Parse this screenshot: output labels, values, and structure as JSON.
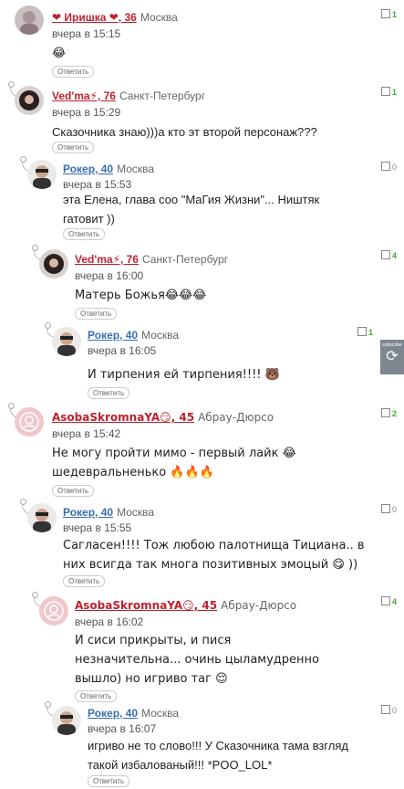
{
  "comments": [
    {
      "author": "❤ Иришка ❤, 36",
      "city": "Москва",
      "time": "вчера в 15:15",
      "text": "😂",
      "reply": "Ответить",
      "rating": "1"
    },
    {
      "author": "Ved'ma⚡, 76",
      "city": "Санкт-Петербург",
      "time": "вчера в 15:29",
      "text": "Сказочника знаю)))а кто эт второй персонаж???",
      "reply": "Ответить",
      "rating": "1"
    },
    {
      "author": "Рокер, 40",
      "city": "Москва",
      "time": "вчера в 15:53",
      "text": "эта Елена, глава соо \"МаГия Жизни\"... Ништяк гатовит ))",
      "reply": "Ответить",
      "rating": "0"
    },
    {
      "author": "Ved'ma⚡, 76",
      "city": "Санкт-Петербург",
      "time": "вчера в 16:00",
      "text": "Матерь Божья😂😂😂",
      "reply": "Ответить",
      "rating": "4"
    },
    {
      "author": "Рокер, 40",
      "city": "Москва",
      "time": "вчера в 16:05",
      "text": "И тирпения ей тирпения!!!! 🐻",
      "reply": "Ответить",
      "rating": "1"
    },
    {
      "author": "AsobaSkromnaYA😏, 45",
      "city": "Абрау-Дюрсо",
      "time": "вчера в 15:42",
      "text": "Не могу пройти мимо - первый лайк 😂 шедевральненько 🔥🔥🔥",
      "reply": "Ответить",
      "rating": "2"
    },
    {
      "author": "Рокер, 40",
      "city": "Москва",
      "time": "вчера в 15:55",
      "text": "Сагласен!!!! Тож любою палотнища Тициана..  в них всигда так многа позитивных эмоцый 😋 ))",
      "reply": "Ответить",
      "rating": "0"
    },
    {
      "author": "AsobaSkromnaYA😏, 45",
      "city": "Абрау-Дюрсо",
      "time": "вчера в 16:02",
      "text": "И сиси прикрыты, и пися незначительна... очинь цыламудренно вышло) но игриво таг 😌",
      "reply": "Ответить",
      "rating": "4"
    },
    {
      "author": "Рокер, 40",
      "city": "Москва",
      "time": "вчера в 16:07",
      "text": "игриво не то слово!!! У Сказочника тама взгляд такой избалованый!!! *POO_LOL*",
      "reply": "Ответить",
      "rating": "0"
    }
  ],
  "side_widget": {
    "label": "subscribe"
  },
  "colors": {
    "author_red": "#c0202e",
    "author_blue": "#3a6fb0",
    "rating_green": "#3aa935"
  }
}
